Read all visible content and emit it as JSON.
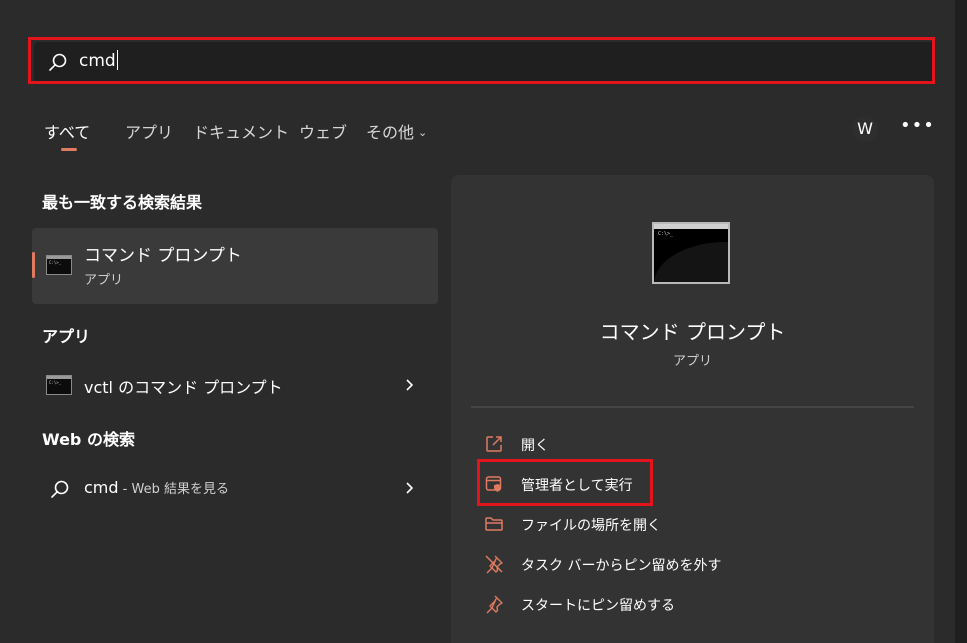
{
  "search": {
    "query": "cmd"
  },
  "tabs": [
    {
      "label": "すべて",
      "active": true
    },
    {
      "label": "アプリ"
    },
    {
      "label": "ドキュメント"
    },
    {
      "label": "ウェブ"
    },
    {
      "label": "その他"
    }
  ],
  "user": {
    "initial": "W"
  },
  "best_match": {
    "heading": "最も一致する検索結果",
    "title": "コマンド プロンプト",
    "subtitle": "アプリ"
  },
  "apps": {
    "heading": "アプリ",
    "items": [
      {
        "label": "vctl のコマンド プロンプト"
      }
    ]
  },
  "web": {
    "heading": "Web の検索",
    "items": [
      {
        "label": "cmd",
        "suffix": " - Web 結果を見る"
      }
    ]
  },
  "detail": {
    "title": "コマンド プロンプト",
    "subtitle": "アプリ",
    "actions": [
      {
        "label": "開く",
        "icon": "open-external-icon"
      },
      {
        "label": "管理者として実行",
        "icon": "shield-admin-icon"
      },
      {
        "label": "ファイルの場所を開く",
        "icon": "folder-icon"
      },
      {
        "label": "タスク バーからピン留めを外す",
        "icon": "unpin-icon"
      },
      {
        "label": "スタートにピン留めする",
        "icon": "pin-icon"
      }
    ]
  },
  "colors": {
    "accent": "#e07b61",
    "highlight": "#e3141c"
  }
}
